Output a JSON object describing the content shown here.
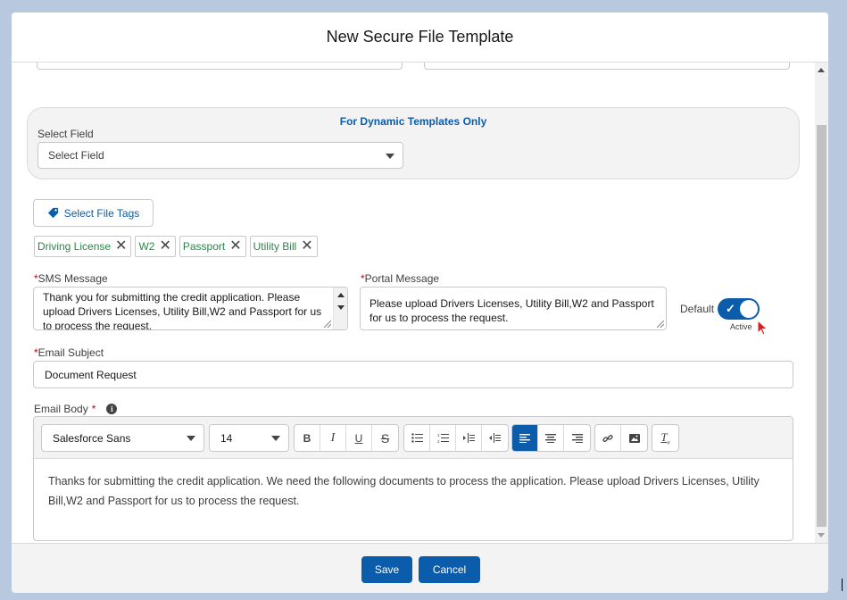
{
  "modal": {
    "title": "New Secure File Template"
  },
  "dynamic": {
    "heading": "For Dynamic Templates Only",
    "select_field_label": "Select Field",
    "select_field_value": "Select Field"
  },
  "tags": {
    "button_label": "Select File Tags",
    "items": [
      "Driving License",
      "W2",
      "Passport",
      "Utility Bill"
    ]
  },
  "sms": {
    "label": "SMS Message",
    "value": "Thank you for submitting the credit application. Please upload Drivers Licenses, Utility Bill,W2 and Passport for us to process the request."
  },
  "portal": {
    "label": "Portal Message",
    "value": "Please upload Drivers Licenses, Utility Bill,W2 and Passport for us to process the request."
  },
  "toggle": {
    "label": "Default",
    "state_label": "Active",
    "checked": true
  },
  "email_subject": {
    "label": "Email Subject",
    "value": "Document Request"
  },
  "email_body": {
    "label": "Email Body",
    "font": "Salesforce Sans",
    "size": "14",
    "content": "Thanks for submitting the credit application. We need the following documents to process the application. Please upload Drivers Licenses, Utility Bill,W2 and Passport for us to process the request."
  },
  "footer": {
    "save_label": "Save",
    "cancel_label": "Cancel"
  },
  "colors": {
    "brand": "#0b5cab",
    "tag_text": "#2e844a",
    "required": "#ba0517"
  }
}
